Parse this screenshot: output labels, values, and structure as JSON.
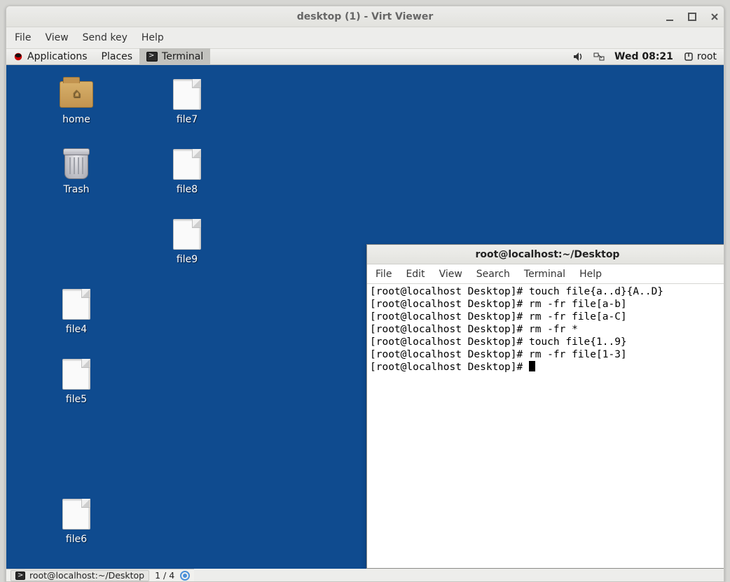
{
  "window": {
    "title": "desktop (1) - Virt Viewer",
    "menu": {
      "file": "File",
      "view": "View",
      "sendkey": "Send key",
      "help": "Help"
    }
  },
  "panel": {
    "applications": "Applications",
    "places": "Places",
    "terminal": "Terminal",
    "datetime": "Wed 08:21",
    "user": "root"
  },
  "desktop_icons": {
    "home": "home",
    "trash": "Trash",
    "file7": "file7",
    "file8": "file8",
    "file9": "file9",
    "file4": "file4",
    "file5": "file5",
    "file6": "file6"
  },
  "terminal": {
    "title": "root@localhost:~/Desktop",
    "menu": {
      "file": "File",
      "edit": "Edit",
      "view": "View",
      "search": "Search",
      "terminal": "Terminal",
      "help": "Help"
    },
    "lines": [
      "[root@localhost Desktop]# touch file{a..d}{A..D}",
      "[root@localhost Desktop]# rm -fr file[a-b]",
      "[root@localhost Desktop]# rm -fr file[a-C]",
      "[root@localhost Desktop]# rm -fr *",
      "[root@localhost Desktop]# touch file{1..9}",
      "[root@localhost Desktop]# rm -fr file[1-3]",
      "[root@localhost Desktop]# "
    ]
  },
  "taskbar": {
    "entry": "root@localhost:~/Desktop",
    "pager": "1 / 4"
  }
}
